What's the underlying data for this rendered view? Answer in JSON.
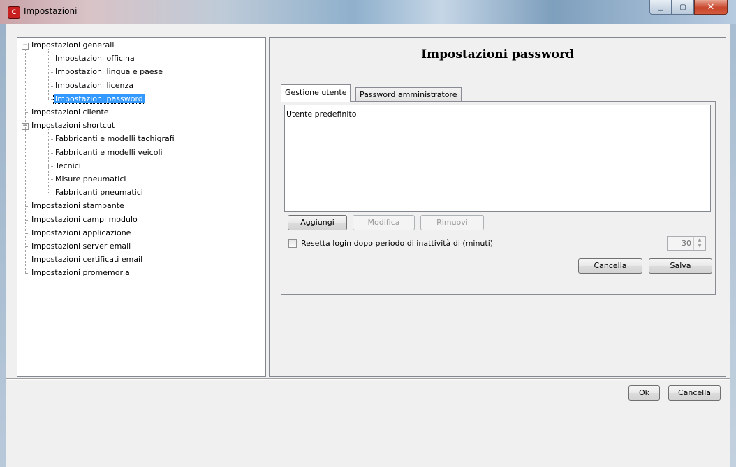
{
  "window": {
    "title": "Impostazioni",
    "icon": "app-logo-icon",
    "controls": {
      "minimize": "minimize-icon",
      "maximize": "maximize-icon",
      "close": "close-icon"
    }
  },
  "tree": {
    "items": [
      {
        "label": "Impostazioni generali",
        "level": 0,
        "expanded": true
      },
      {
        "label": "Impostazioni officina",
        "level": 1
      },
      {
        "label": "Impostazioni lingua e paese",
        "level": 1
      },
      {
        "label": "Impostazioni licenza",
        "level": 1
      },
      {
        "label": "Impostazioni password",
        "level": 1,
        "selected": true
      },
      {
        "label": "Impostazioni cliente",
        "level": 0
      },
      {
        "label": "Impostazioni shortcut",
        "level": 0,
        "expanded": true
      },
      {
        "label": "Fabbricanti e modelli tachigrafi",
        "level": 1
      },
      {
        "label": "Fabbricanti e modelli veicoli",
        "level": 1
      },
      {
        "label": "Tecnici",
        "level": 1
      },
      {
        "label": "Misure pneumatici",
        "level": 1
      },
      {
        "label": "Fabbricanti pneumatici",
        "level": 1
      },
      {
        "label": "Impostazioni stampante",
        "level": 0
      },
      {
        "label": "Impostazioni campi modulo",
        "level": 0
      },
      {
        "label": "Impostazioni applicazione",
        "level": 0
      },
      {
        "label": "Impostazioni server email",
        "level": 0
      },
      {
        "label": "Impostazioni certificati email",
        "level": 0
      },
      {
        "label": "Impostazioni promemoria",
        "level": 0
      }
    ]
  },
  "panel": {
    "title": "Impostazioni password",
    "tabs": [
      {
        "label": "Gestione utente",
        "active": true
      },
      {
        "label": "Password amministratore",
        "active": false
      }
    ],
    "user_list": {
      "items": [
        "Utente predefinito"
      ]
    },
    "buttons": {
      "add": "Aggiungi",
      "edit": "Modifica",
      "remove": "Rimuovi",
      "cancel": "Cancella",
      "save": "Salva"
    },
    "reset_login": {
      "label": "Resetta login dopo periodo di inattività di (minuti)",
      "checked": false,
      "minutes": "30"
    }
  },
  "footer": {
    "ok": "Ok",
    "cancel": "Cancella"
  },
  "colors": {
    "selection": "#3399ff",
    "window_bg": "#f0f0f0",
    "close_button": "#c7462b"
  }
}
